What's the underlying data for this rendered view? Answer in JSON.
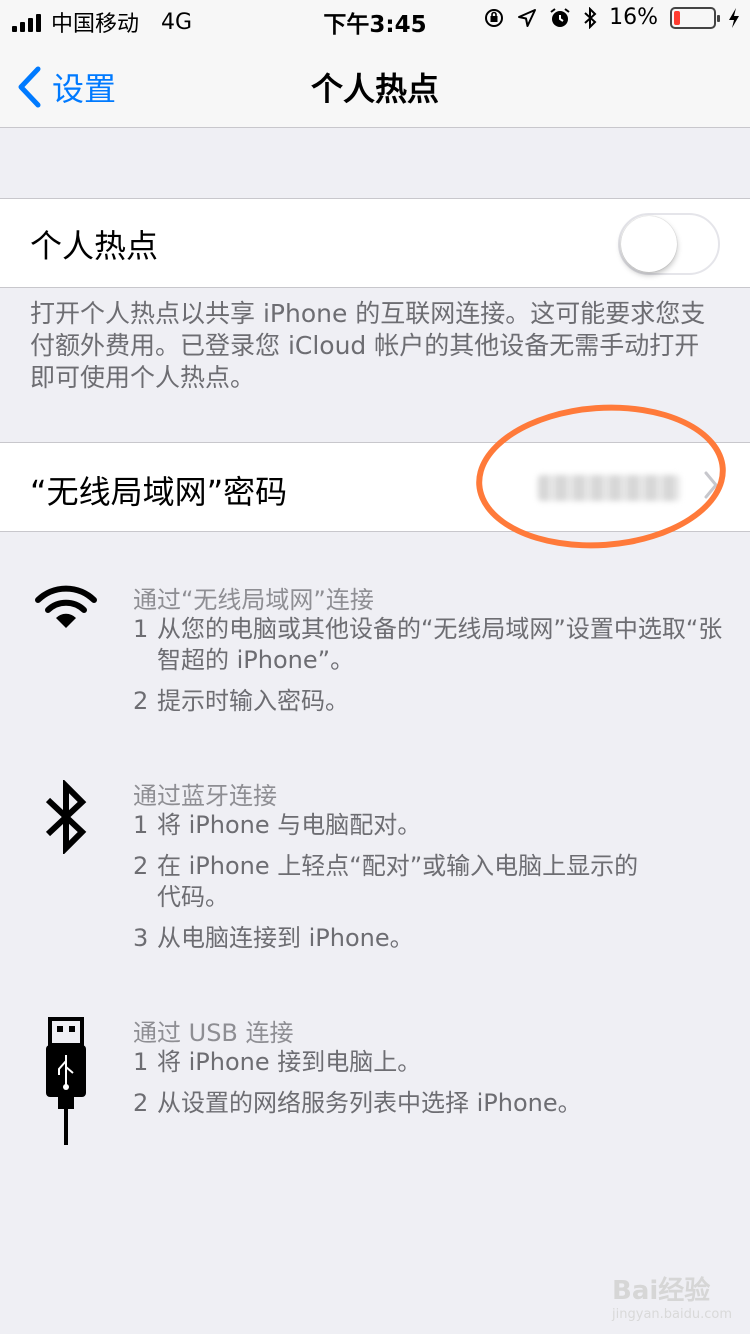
{
  "status_bar": {
    "carrier": "中国移动",
    "network": "4G",
    "time": "下午3:45",
    "battery_percent": "16%",
    "battery_level": 0.16,
    "battery_color": "#ff3b30"
  },
  "nav": {
    "back_label": "设置",
    "title": "个人热点",
    "accent_color": "#007aff"
  },
  "hotspot": {
    "label": "个人热点",
    "enabled": false,
    "note": "打开个人热点以共享 iPhone 的互联网连接。这可能要求您支付额外费用。已登录您 iCloud 帐户的其他设备无需手动打开即可使用个人热点。"
  },
  "wifi_password": {
    "label": "“无线局域网”密码"
  },
  "instructions": {
    "wifi": {
      "icon": "wifi-icon",
      "title": "通过“无线局域网”连接",
      "steps": [
        {
          "num": "1",
          "text": "从您的电脑或其他设备的“无线局域网”设置中选取“张智超的 iPhone”。"
        },
        {
          "num": "2",
          "text": "提示时输入密码。"
        }
      ]
    },
    "bluetooth": {
      "icon": "bluetooth-icon",
      "title": "通过蓝牙连接",
      "steps": [
        {
          "num": "1",
          "text": "将 iPhone 与电脑配对。"
        },
        {
          "num": "2",
          "text": "在 iPhone 上轻点“配对”或输入电脑上显示的代码。"
        },
        {
          "num": "3",
          "text": "从电脑连接到 iPhone。"
        }
      ]
    },
    "usb": {
      "icon": "usb-icon",
      "title": "通过 USB 连接",
      "steps": [
        {
          "num": "1",
          "text": "将 iPhone 接到电脑上。"
        },
        {
          "num": "2",
          "text": "从设置的网络服务列表中选择 iPhone。"
        }
      ]
    }
  },
  "watermark": {
    "brand": "Bai经验",
    "url": "jingyan.baidu.com"
  }
}
